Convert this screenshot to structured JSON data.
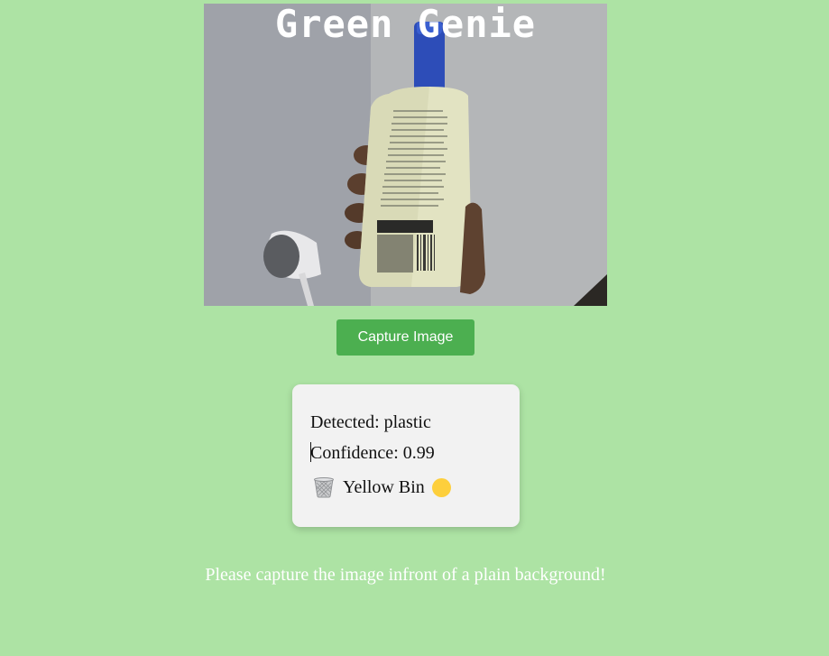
{
  "app": {
    "title": "Green Genie"
  },
  "camera": {
    "scene_description_icon": "camera-feed"
  },
  "capture_button": {
    "label": "Capture Image"
  },
  "result": {
    "detected_label": "Detected: plastic",
    "confidence_label": "Confidence: 0.99",
    "bin_label": "Yellow Bin",
    "bin_icon": "wastebasket-icon",
    "bin_color": "#fdcf3c"
  },
  "instruction": {
    "text": "Please capture the image infront of a plain background!"
  },
  "colors": {
    "background": "#ade3a4",
    "button": "#4caf50",
    "card": "#f2f2f2"
  }
}
